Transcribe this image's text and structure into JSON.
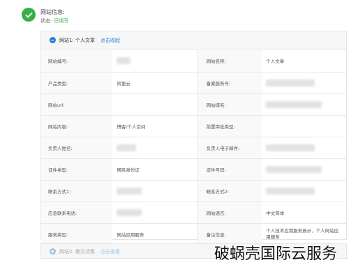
{
  "header": {
    "title": "网站信息:",
    "status_label": "状态:",
    "status_value": "已填写",
    "status_color": "#3aae4a"
  },
  "panel1": {
    "title_prefix": "网站1:",
    "title_name": "个人文章",
    "toggle_label": "点击收起",
    "rows": [
      {
        "label_left": "网站编号:",
        "value_left": "",
        "label_right": "网站名称:",
        "value_right": "个人文章"
      },
      {
        "label_left": "产品类型:",
        "value_left": "阿里云",
        "label_right": "备案服务号:",
        "value_right": ""
      },
      {
        "label_left": "网站url:",
        "value_left": "",
        "label_right": "网站域名:",
        "value_right": ""
      },
      {
        "label_left": "网站内容:",
        "value_left": "博客/个人空间",
        "label_right": "前置审批类型:",
        "value_right": ""
      },
      {
        "label_left": "负责人姓名:",
        "value_left": "",
        "label_right": "负责人电子邮件:",
        "value_right": ""
      },
      {
        "label_left": "证件类型:",
        "value_left": "居民身份证",
        "label_right": "证件号码:",
        "value_right": ""
      },
      {
        "label_left": "联系方式1:",
        "value_left": "",
        "label_right": "联系方式2:",
        "value_right": ""
      },
      {
        "label_left": "应急联系电话:",
        "value_left": "",
        "label_right": "网站语言:",
        "value_right": "中文简体"
      },
      {
        "label_left": "服务类型:",
        "value_left": "网站应用服务",
        "label_right": "备注信息:",
        "value_right": "个人技术应用服务展示，个人网站应用服务"
      }
    ]
  },
  "panel2": {
    "title_prefix": "网站2:",
    "title_name": "散文诗集",
    "toggle_label": "点击查看"
  },
  "watermark": "破蜗壳国际云服务",
  "colors": {
    "accent": "#1f7fd6",
    "success": "#3aae4a"
  },
  "icons": {
    "status": "check-circle-icon",
    "collapse": "minus-circle-icon",
    "expand": "plus-circle-icon"
  }
}
